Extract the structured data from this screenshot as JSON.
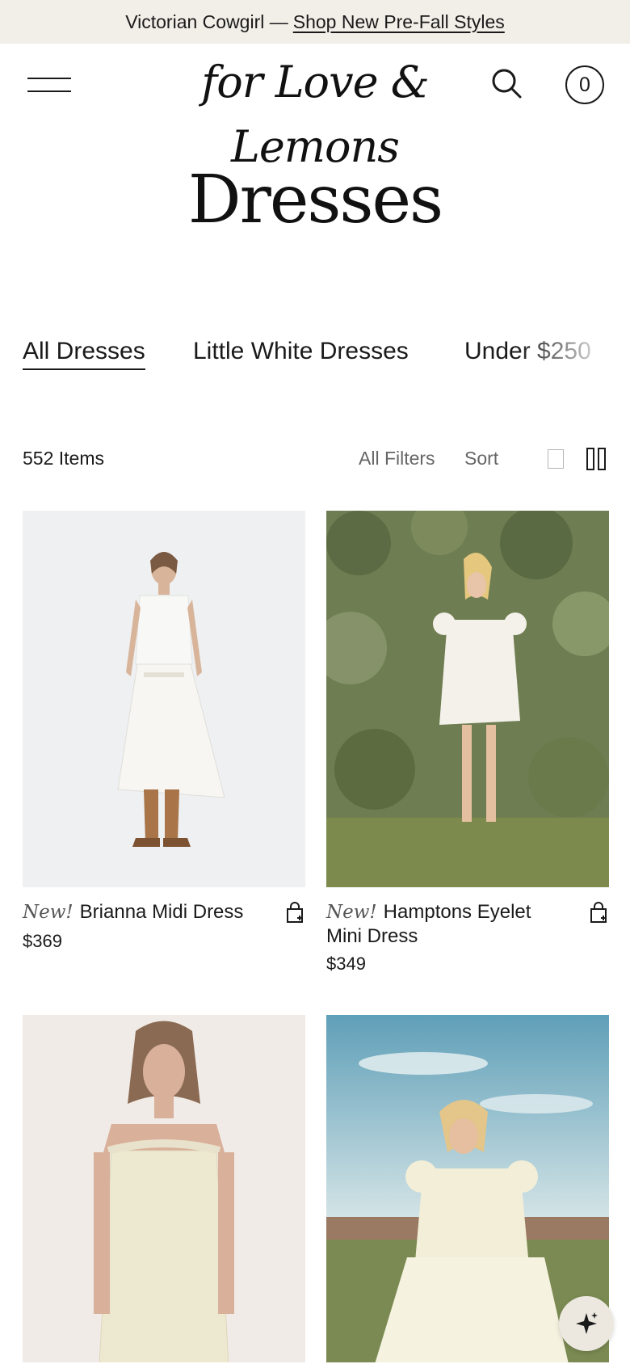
{
  "announcement": {
    "text": "Victorian Cowgirl —",
    "link_label": "Shop New Pre-Fall Styles"
  },
  "header": {
    "logo_text": "for Love & Lemons",
    "cart_count": "0"
  },
  "page": {
    "title": "Dresses"
  },
  "category_tabs": [
    {
      "label": "All Dresses",
      "active": true
    },
    {
      "label": "Little White Dresses",
      "active": false
    },
    {
      "label": "Under $250",
      "active": false
    }
  ],
  "toolbar": {
    "item_count": "552 Items",
    "filters_label": "All Filters",
    "sort_label": "Sort"
  },
  "products": [
    {
      "badge": "New!",
      "name": "Brianna Midi Dress",
      "price": "$369"
    },
    {
      "badge": "New!",
      "name": "Hamptons Eyelet Mini Dress",
      "price": "$349"
    }
  ],
  "colors": {
    "announcement_bg": "#f2efe9",
    "text": "#1a1a1a",
    "muted": "#666666"
  }
}
